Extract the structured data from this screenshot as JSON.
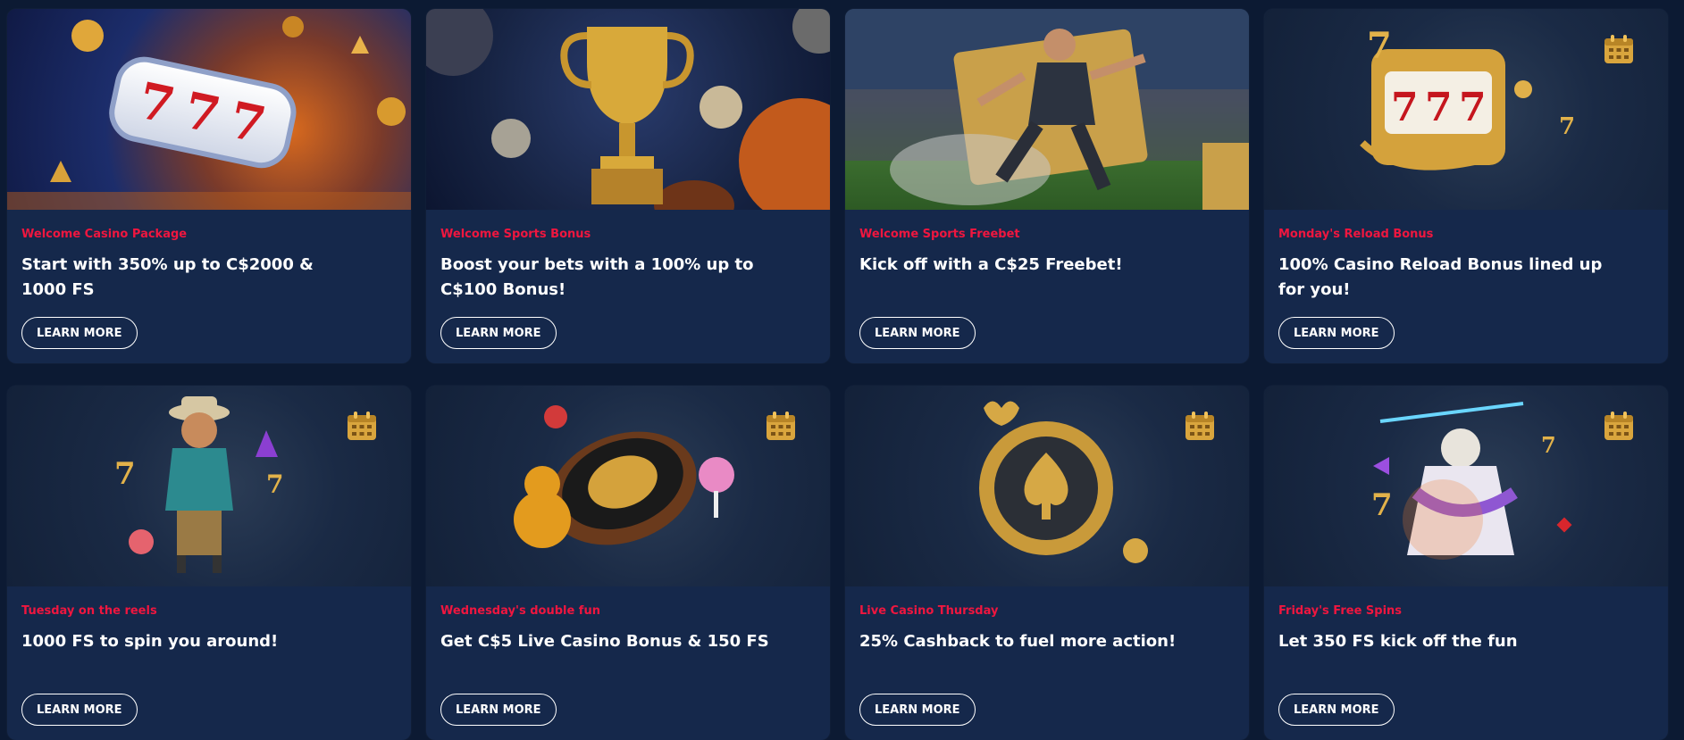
{
  "cards": [
    {
      "category": "Welcome Casino Package",
      "title": "Start with 350% up to C$2000 & 1000 FS",
      "button": "LEARN MORE",
      "image": "slot-777-reel"
    },
    {
      "category": "Welcome Sports Bonus",
      "title": "Boost your bets with a 100% up to C$100 Bonus!",
      "button": "LEARN MORE",
      "image": "gold-trophy-balls"
    },
    {
      "category": "Welcome Sports Freebet",
      "title": "Kick off with a C$25 Freebet!",
      "button": "LEARN MORE",
      "image": "footballer-ticket"
    },
    {
      "category": "Monday's Reload Bonus",
      "title": "100% Casino Reload Bonus lined up for you!",
      "button": "LEARN MORE",
      "image": "gold-slot-machine"
    },
    {
      "category": "Tuesday on the reels",
      "title": "1000 FS to spin you around!",
      "button": "LEARN MORE",
      "image": "cowboy-character"
    },
    {
      "category": "Wednesday's double fun",
      "title": "Get C$5 Live Casino Bonus & 150 FS",
      "button": "LEARN MORE",
      "image": "roulette-bear"
    },
    {
      "category": "Live Casino Thursday",
      "title": "25% Cashback to fuel more action!",
      "button": "LEARN MORE",
      "image": "spade-chip"
    },
    {
      "category": "Friday's Free Spins",
      "title": "Let 350 FS kick off the fun",
      "button": "LEARN MORE",
      "image": "zeus-character"
    }
  ],
  "colors": {
    "page_bg": "#0c1a33",
    "card_bg": "#15284b",
    "category": "#f0163f",
    "title": "#ffffff"
  },
  "icons": {
    "calendar": "calendar-icon"
  }
}
